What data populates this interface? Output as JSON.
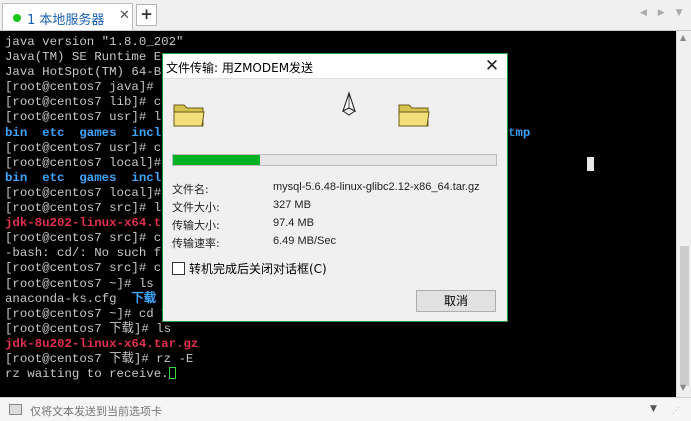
{
  "tab": {
    "label": "1 本地服务器",
    "close_glyph": "✕",
    "add_glyph": "+",
    "status_color": "#18c818"
  },
  "nav": {
    "arrows": "◀ ▶ ▼"
  },
  "terminal": {
    "lines": [
      {
        "segs": [
          {
            "t": "java version \"1.8.0_202\"",
            "c": "#c7c7c7"
          }
        ]
      },
      {
        "segs": [
          {
            "t": "Java(TM) SE Runtime En",
            "c": "#c7c7c7"
          }
        ]
      },
      {
        "segs": [
          {
            "t": "Java HotSpot(TM) 64-Bi",
            "c": "#c7c7c7"
          }
        ]
      },
      {
        "segs": [
          {
            "t": "[root@centos7 java]# c",
            "c": "#c7c7c7"
          }
        ]
      },
      {
        "segs": [
          {
            "t": "[root@centos7 lib]# cd",
            "c": "#c7c7c7"
          }
        ]
      },
      {
        "segs": [
          {
            "t": "[root@centos7 usr]# ls",
            "c": "#c7c7c7"
          }
        ]
      },
      {
        "segs": [
          {
            "t": "bin  etc  games  inclu",
            "c": "#3fa6ff",
            "b": true
          }
        ]
      },
      {
        "segs": [
          {
            "t": "[root@centos7 usr]# cd",
            "c": "#c7c7c7"
          }
        ]
      },
      {
        "segs": [
          {
            "t": "[root@centos7 local]# ",
            "c": "#c7c7c7"
          }
        ]
      },
      {
        "segs": [
          {
            "t": "bin  etc  games  inclu",
            "c": "#3fa6ff",
            "b": true
          }
        ]
      },
      {
        "segs": [
          {
            "t": "[root@centos7 local]# ",
            "c": "#c7c7c7"
          }
        ]
      },
      {
        "segs": [
          {
            "t": "[root@centos7 src]# ls",
            "c": "#c7c7c7"
          }
        ]
      },
      {
        "segs": [
          {
            "t": "jdk-8u202-linux-x64.ta",
            "c": "#e0304e",
            "b": true
          }
        ]
      },
      {
        "segs": [
          {
            "t": "[root@centos7 src]# cd",
            "c": "#c7c7c7"
          }
        ]
      },
      {
        "segs": [
          {
            "t": "-bash: cd/: No such fi",
            "c": "#c7c7c7"
          }
        ]
      },
      {
        "segs": [
          {
            "t": "[root@centos7 src]# cd",
            "c": "#c7c7c7"
          }
        ]
      },
      {
        "segs": [
          {
            "t": "[root@centos7 ~]# ls",
            "c": "#c7c7c7"
          }
        ]
      },
      {
        "segs": [
          {
            "t": "anaconda-ks.cfg  ",
            "c": "#c7c7c7"
          },
          {
            "t": "下载",
            "c": "#3fa6ff",
            "b": true
          }
        ]
      },
      {
        "segs": [
          {
            "t": "[root@centos7 ~]# cd T",
            "c": "#c7c7c7"
          }
        ]
      },
      {
        "segs": [
          {
            "t": "[root@centos7 下载]# ls",
            "c": "#c7c7c7"
          }
        ]
      },
      {
        "segs": [
          {
            "t": "jdk-8u202-linux-x64.tar.gz",
            "c": "#e0304e",
            "b": true
          }
        ]
      },
      {
        "segs": [
          {
            "t": "[root@centos7 下载]# rz -E",
            "c": "#c7c7c7"
          }
        ]
      },
      {
        "segs": [
          {
            "t": "rz waiting to receive.",
            "c": "#c7c7c7"
          }
        ],
        "caret": true
      }
    ],
    "right_fragment": "tmp",
    "caret_color": "#3fd13f"
  },
  "sendbar": {
    "placeholder": "仅将文本发送到当前选项卡",
    "menu_glyph": "▼"
  },
  "dialog": {
    "title": "文件传输: 用ZMODEM发送",
    "close_glyph": "✕",
    "progress_fraction": 0.27,
    "progress_color": "#06b025",
    "info": [
      {
        "label": "文件名:",
        "value": "mysql-5.6.48-linux-glibc2.12-x86_64.tar.gz"
      },
      {
        "label": "文件大小:",
        "value": "327 MB"
      },
      {
        "label": "传输大小:",
        "value": "97.4 MB"
      },
      {
        "label": "传输速率:",
        "value": "6.49 MB/Sec"
      }
    ],
    "close_on_complete_label": "转机完成后关闭对话框(C)",
    "close_on_complete_checked": false,
    "cancel_label": "取消",
    "icons": {
      "source": "folder-icon",
      "transfer": "paper-plane-icon",
      "destination": "folder-icon"
    }
  }
}
